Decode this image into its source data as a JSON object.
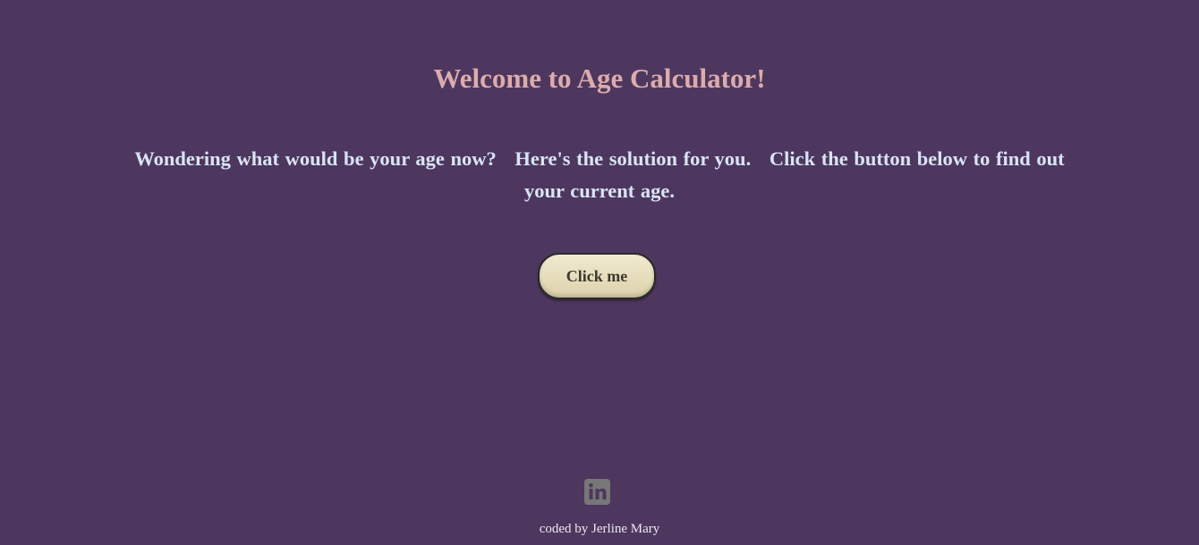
{
  "page": {
    "title": "Welcome to Age Calculator!",
    "intro": {
      "part1": "Wondering what would be your age now?",
      "part2": "Here's the solution for you.",
      "part3": "Click the button below to find out your current age."
    },
    "button_label": "Click me",
    "social_icon": "linkedin-icon",
    "footer_text": "coded by Jerline Mary"
  },
  "colors": {
    "background": "#4d375e",
    "title": "#dcabab",
    "intro_text": "#d8e4f5",
    "button_bg": "#e8dfbe",
    "icon": "#777777",
    "footer_text": "#eee7f2"
  }
}
